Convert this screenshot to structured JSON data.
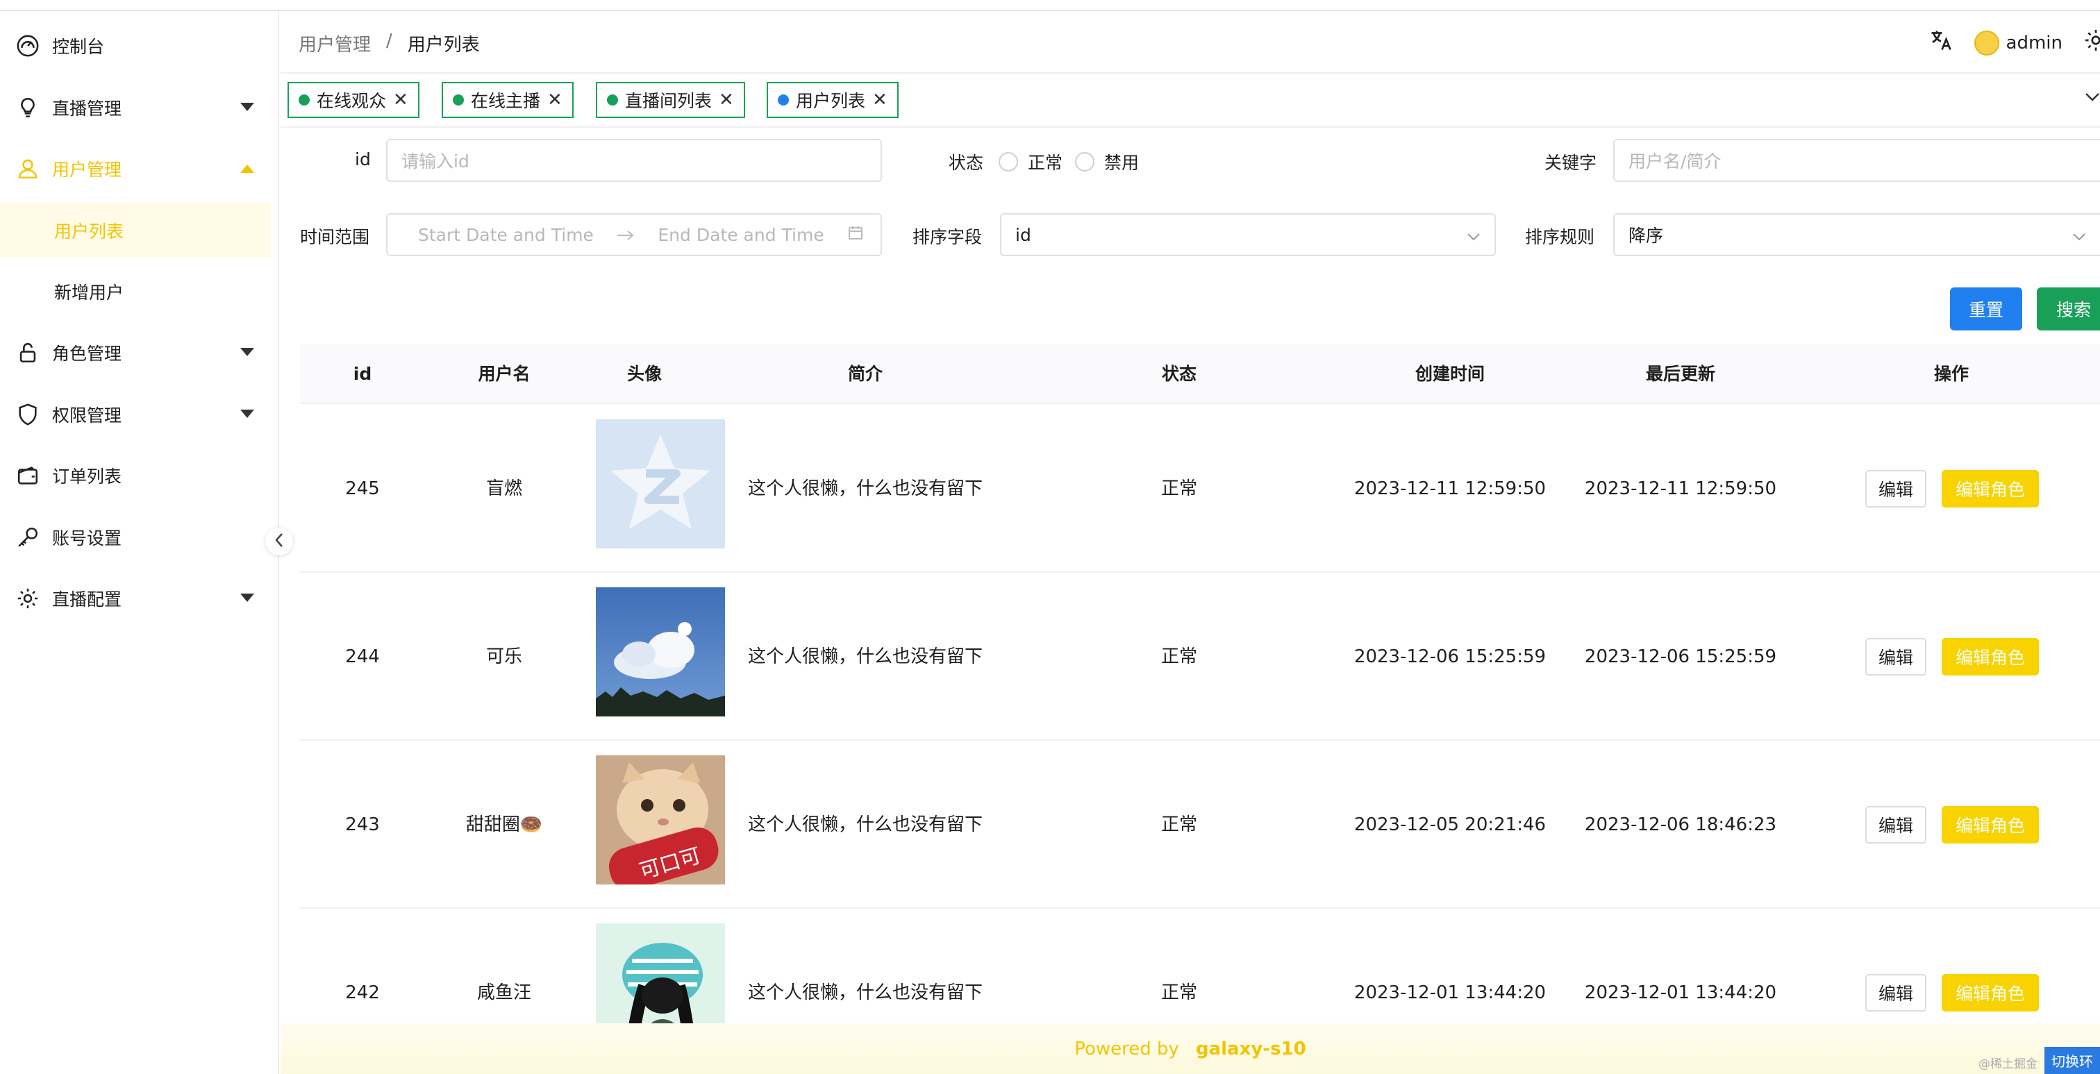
{
  "sidebar": {
    "items": [
      {
        "label": "控制台",
        "icon": "dashboard-icon"
      },
      {
        "label": "直播管理",
        "icon": "bulb-icon"
      },
      {
        "label": "用户管理",
        "icon": "user-icon"
      },
      {
        "label": "角色管理",
        "icon": "lock-icon"
      },
      {
        "label": "权限管理",
        "icon": "shield-icon"
      },
      {
        "label": "订单列表",
        "icon": "wallet-icon"
      },
      {
        "label": "账号设置",
        "icon": "key-icon"
      },
      {
        "label": "直播配置",
        "icon": "gear-icon"
      }
    ],
    "submenu": [
      {
        "label": "用户列表"
      },
      {
        "label": "新增用户"
      }
    ],
    "accent_color": "#f2c400"
  },
  "header": {
    "breadcrumb": [
      "用户管理",
      "用户列表"
    ],
    "breadcrumb_sep": "/",
    "username": "admin"
  },
  "tags": [
    {
      "label": "在线观众"
    },
    {
      "label": "在线主播"
    },
    {
      "label": "直播间列表"
    },
    {
      "label": "用户列表"
    }
  ],
  "filters": {
    "id_label": "id",
    "id_placeholder": "请输入id",
    "status_label": "状态",
    "status_options": [
      "正常",
      "禁用"
    ],
    "keyword_label": "关键字",
    "keyword_placeholder": "用户名/简介",
    "time_label": "时间范围",
    "start_placeholder": "Start Date and Time",
    "end_placeholder": "End Date and Time",
    "sort_field_label": "排序字段",
    "sort_field_value": "id",
    "sort_rule_label": "排序规则",
    "sort_rule_value": "降序",
    "reset_label": "重置",
    "search_label": "搜索"
  },
  "table": {
    "columns": [
      "id",
      "用户名",
      "头像",
      "简介",
      "状态",
      "创建时间",
      "最后更新",
      "操作"
    ],
    "rows": [
      {
        "id": "245",
        "username": "盲燃",
        "avatar": "qq-default-avatar",
        "bio": "这个人很懒，什么也没有留下",
        "status": "正常",
        "created": "2023-12-11 12:59:50",
        "updated": "2023-12-11 12:59:50"
      },
      {
        "id": "244",
        "username": "可乐",
        "avatar": "sky-cloud-photo",
        "bio": "这个人很懒，什么也没有留下",
        "status": "正常",
        "created": "2023-12-06 15:25:59",
        "updated": "2023-12-06 15:25:59"
      },
      {
        "id": "243",
        "username": "甜甜圈🍩",
        "avatar": "cat-with-can-photo",
        "bio": "这个人很懒，什么也没有留下",
        "status": "正常",
        "created": "2023-12-05 20:21:46",
        "updated": "2023-12-06 18:46:23"
      },
      {
        "id": "242",
        "username": "咸鱼汪",
        "avatar": "anime-character-photo",
        "bio": "这个人很懒，什么也没有留下",
        "status": "正常",
        "created": "2023-12-01 13:44:20",
        "updated": "2023-12-01 13:44:20"
      }
    ],
    "edit_label": "编辑",
    "edit_role_label": "编辑角色"
  },
  "footer": {
    "prefix": "Powered by",
    "brand": "galaxy-s10"
  },
  "corner": {
    "watermark": "@稀土掘金",
    "switch_label": "切换环"
  },
  "colors": {
    "primary_blue": "#2080f0",
    "success_green": "#18a058",
    "warning_yellow": "#f8d300"
  }
}
